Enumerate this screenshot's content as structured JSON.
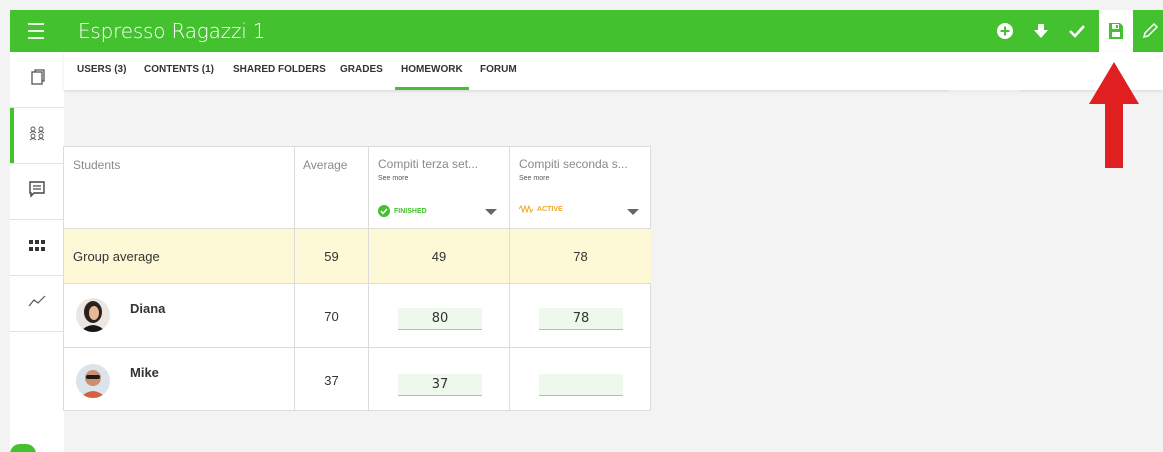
{
  "app": {
    "title": "Espresso Ragazzi 1"
  },
  "toolbar": {
    "icons": [
      "plus-circle-icon",
      "download-arrow-icon",
      "checkmark-icon",
      "save-floppy-icon",
      "pencil-icon"
    ]
  },
  "sidebar": {
    "items": [
      {
        "icon": "pages-icon"
      },
      {
        "icon": "users-group-icon",
        "active": true
      },
      {
        "icon": "chat-bubble-icon"
      },
      {
        "icon": "apps-grid-icon"
      },
      {
        "icon": "trend-line-icon"
      }
    ]
  },
  "tabs": [
    {
      "label": "USERS (3)"
    },
    {
      "label": "CONTENTS (1)"
    },
    {
      "label": "SHARED FOLDERS"
    },
    {
      "label": "GRADES"
    },
    {
      "label": "HOMEWORK",
      "active": true
    },
    {
      "label": "FORUM"
    }
  ],
  "table": {
    "headers": {
      "students": "Students",
      "average": "Average"
    },
    "homework": [
      {
        "title": "Compiti terza set...",
        "see_more": "See more",
        "status": "FINISHED",
        "status_color": "#44c12f",
        "status_icon": "check-circle-icon"
      },
      {
        "title": "Compiti seconda s...",
        "see_more": "See more",
        "status": "ACTIVE",
        "status_color": "#f5a623",
        "status_icon": "active-wave-icon"
      }
    ],
    "group_average": {
      "label": "Group average",
      "average": "59",
      "grades": [
        "49",
        "78"
      ]
    },
    "students": [
      {
        "name": "Diana",
        "average": "70",
        "grades": [
          "80",
          "78"
        ]
      },
      {
        "name": "Mike",
        "average": "37",
        "grades": [
          "37",
          ""
        ]
      }
    ]
  },
  "colors": {
    "accent": "#44c12f",
    "highlight_row": "#fdf8d5",
    "annotation_arrow": "#e02020"
  }
}
